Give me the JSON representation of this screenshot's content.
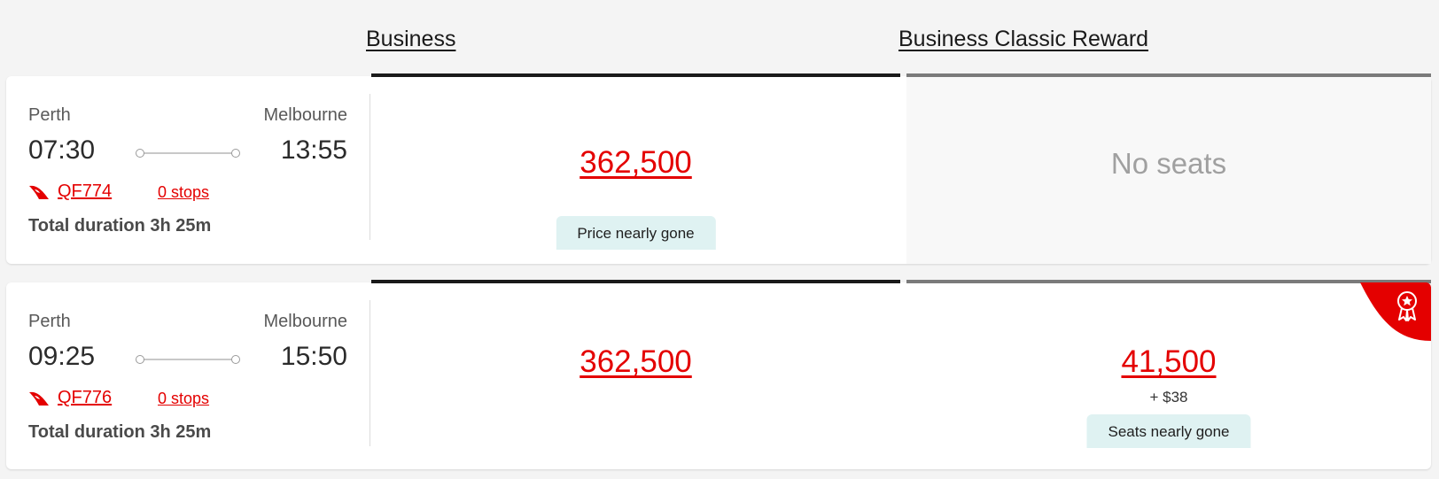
{
  "columns": {
    "business": "Business",
    "reward": "Business Classic Reward"
  },
  "flights": [
    {
      "from": "Perth",
      "to": "Melbourne",
      "departure": "07:30",
      "arrival": "13:55",
      "flight_number": "QF774",
      "stops": "0 stops",
      "duration": "Total duration 3h 25m",
      "business": {
        "price": "362,500",
        "badge": "Price nearly gone"
      },
      "reward": {
        "status": "No seats"
      }
    },
    {
      "from": "Perth",
      "to": "Melbourne",
      "departure": "09:25",
      "arrival": "15:50",
      "flight_number": "QF776",
      "stops": "0 stops",
      "duration": "Total duration 3h 25m",
      "business": {
        "price": "362,500"
      },
      "reward": {
        "price": "41,500",
        "surcharge": "+ $38",
        "badge": "Seats nearly gone"
      }
    }
  ],
  "icons": {
    "airline": "qantas-kangaroo-icon",
    "award": "award-ribbon-icon"
  },
  "colors": {
    "accent": "#e40000",
    "badge_bg": "#dff2f2"
  }
}
